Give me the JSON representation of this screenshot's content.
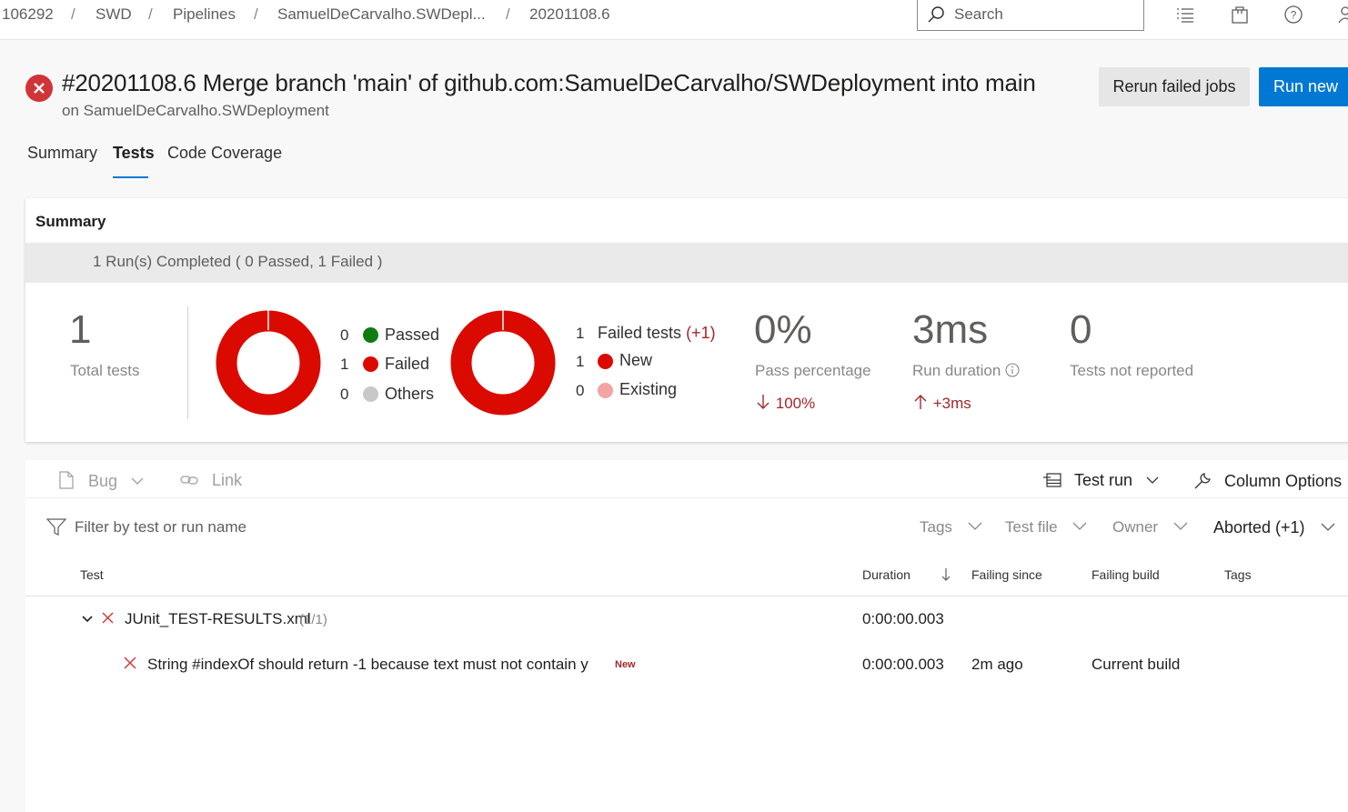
{
  "breadcrumb": {
    "items": [
      "106292",
      "SWD",
      "Pipelines",
      "SamuelDeCarvalho.SWDepl...",
      "20201108.6"
    ],
    "separator": "/"
  },
  "search": {
    "placeholder": "Search"
  },
  "header": {
    "title": "#20201108.6 Merge branch 'main' of github.com:SamuelDeCarvalho/SWDeployment into main",
    "subtitle": "on SamuelDeCarvalho.SWDeployment",
    "rerun_label": "Rerun failed jobs",
    "run_new_label": "Run new",
    "status": "failed"
  },
  "tabs": [
    "Summary",
    "Tests",
    "Code Coverage"
  ],
  "active_tab": "Tests",
  "summary": {
    "title": "Summary",
    "runs_text": "1 Run(s) Completed ( 0 Passed, 1 Failed )",
    "total_tests": {
      "value": "1",
      "label": "Total tests"
    },
    "outcome_legend": [
      {
        "count": "0",
        "label": "Passed",
        "color": "#107c10"
      },
      {
        "count": "1",
        "label": "Failed",
        "color": "#da0a00"
      },
      {
        "count": "0",
        "label": "Others",
        "color": "#c8c8c8"
      }
    ],
    "failed_legend": [
      {
        "count": "1",
        "label": "Failed tests",
        "delta": "(+1)"
      },
      {
        "count": "1",
        "label": "New",
        "color": "#da0a00"
      },
      {
        "count": "0",
        "label": "Existing",
        "color": "#f4a3a3"
      }
    ],
    "pass_percentage": {
      "value": "0%",
      "label": "Pass percentage",
      "trend": "100%"
    },
    "run_duration": {
      "value": "3ms",
      "label": "Run duration",
      "trend": "+3ms"
    },
    "not_reported": {
      "value": "0",
      "label": "Tests not reported"
    },
    "donut_color": "#da0a00"
  },
  "toolbar": {
    "bug_label": "Bug",
    "link_label": "Link",
    "test_run_label": "Test run",
    "column_options_label": "Column Options"
  },
  "filters": {
    "placeholder": "Filter by test or run name",
    "tags_label": "Tags",
    "test_file_label": "Test file",
    "owner_label": "Owner",
    "outcome_label": "Aborted (+1)"
  },
  "grid": {
    "columns": [
      "Test",
      "Duration",
      "Failing since",
      "Failing build",
      "Tags"
    ],
    "group": {
      "name": "JUnit_TEST-RESULTS.xml",
      "count": "(1/1)",
      "duration": "0:00:00.003"
    },
    "rows": [
      {
        "name": "String #indexOf should return -1 because text must not contain y",
        "badge": "New",
        "duration": "0:00:00.003",
        "failing_since": "2m ago",
        "failing_build": "Current build",
        "tags": ""
      }
    ]
  }
}
